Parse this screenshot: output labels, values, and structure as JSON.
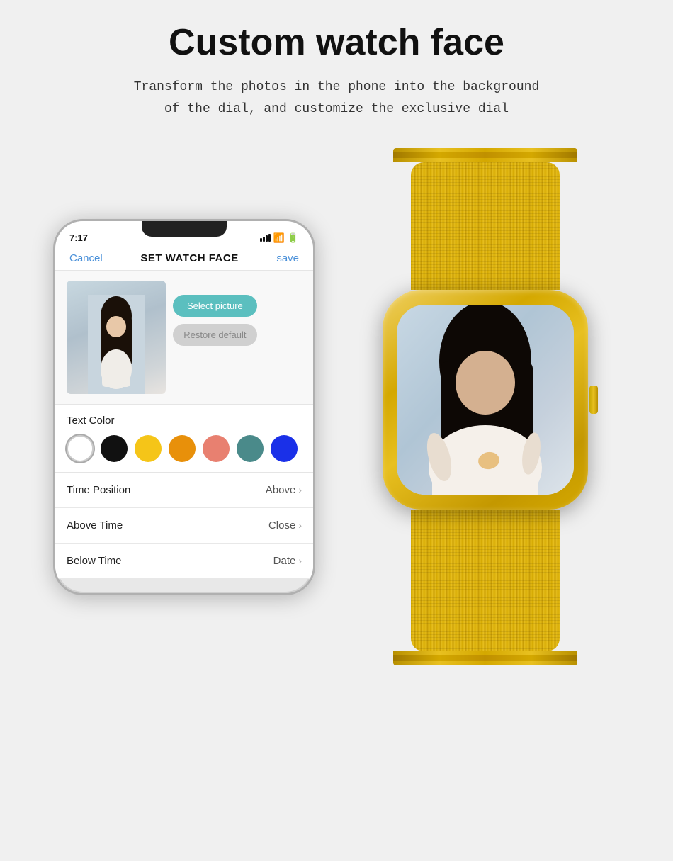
{
  "title": "Custom watch face",
  "subtitle_line1": "Transform the photos in the phone into the background",
  "subtitle_line2": "of the dial, and customize the exclusive dial",
  "phone": {
    "status_time": "7:17",
    "nav_cancel": "Cancel",
    "nav_title": "SET WATCH FACE",
    "nav_save": "save",
    "select_btn": "Select picture",
    "restore_btn": "Restore default",
    "text_color_label": "Text Color",
    "colors": [
      "white",
      "black",
      "yellow",
      "orange",
      "salmon",
      "teal",
      "blue"
    ],
    "settings": [
      {
        "label": "Time Position",
        "value": "Above"
      },
      {
        "label": "Above Time",
        "value": "Close"
      },
      {
        "label": "Below Time",
        "value": "Date"
      }
    ]
  },
  "icons": {
    "chevron": "›"
  }
}
